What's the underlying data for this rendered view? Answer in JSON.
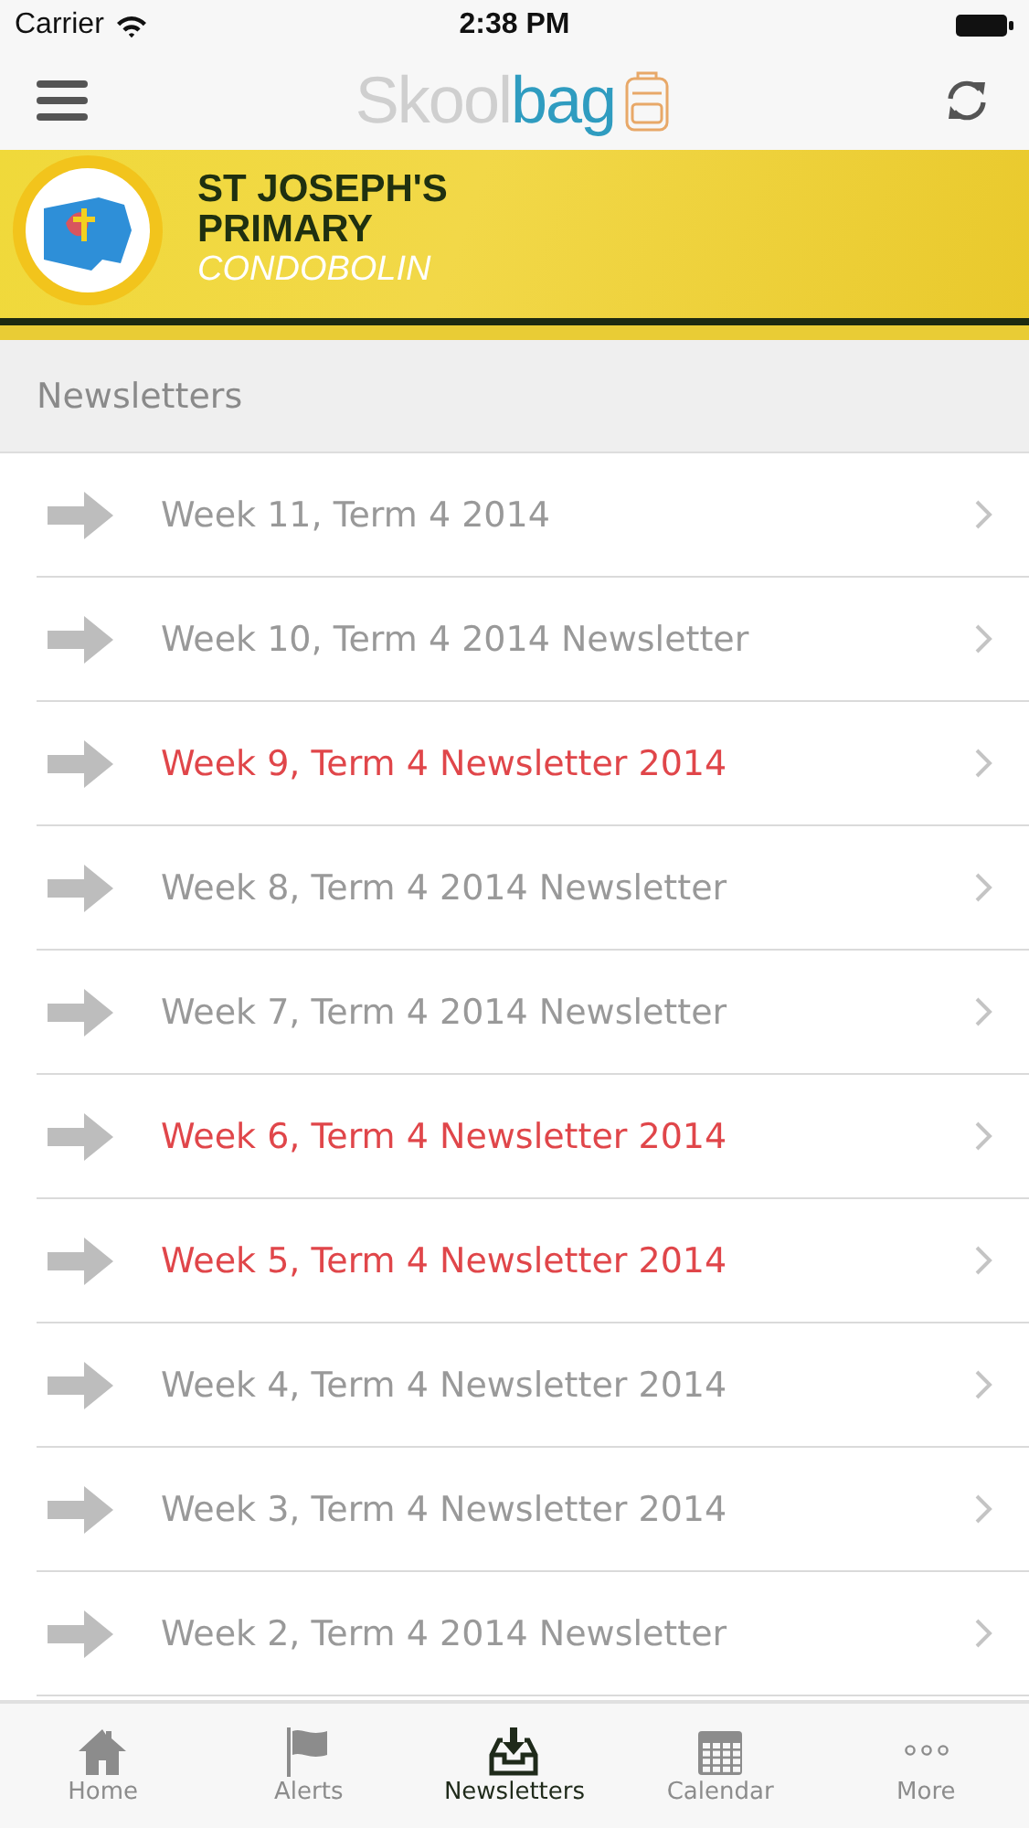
{
  "status_bar": {
    "carrier": "Carrier",
    "time": "2:38 PM"
  },
  "nav_bar": {
    "logo": {
      "first": "Skool",
      "second": "bag"
    }
  },
  "banner": {
    "line1": "ST JOSEPH'S",
    "line2": "PRIMARY",
    "line3": "CONDOBOLIN"
  },
  "section": {
    "title": "Newsletters"
  },
  "items": [
    {
      "label": "Week 11, Term 4 2014",
      "unread": false
    },
    {
      "label": "Week 10, Term 4 2014 Newsletter",
      "unread": false
    },
    {
      "label": "Week 9, Term 4 Newsletter 2014",
      "unread": true
    },
    {
      "label": "Week 8, Term 4 2014 Newsletter",
      "unread": false
    },
    {
      "label": "Week 7, Term 4 2014 Newsletter",
      "unread": false
    },
    {
      "label": "Week 6, Term 4 Newsletter 2014",
      "unread": true
    },
    {
      "label": "Week 5, Term 4 Newsletter 2014",
      "unread": true
    },
    {
      "label": "Week 4, Term 4 Newsletter 2014",
      "unread": false
    },
    {
      "label": "Week 3, Term 4 Newsletter 2014",
      "unread": false
    },
    {
      "label": "Week 2, Term 4 2014 Newsletter",
      "unread": false
    }
  ],
  "tab_bar": [
    {
      "label": "Home",
      "kind": "home",
      "selected": false
    },
    {
      "label": "Alerts",
      "kind": "alerts",
      "selected": false
    },
    {
      "label": "Newsletters",
      "kind": "newsletters",
      "selected": true
    },
    {
      "label": "Calendar",
      "kind": "calendar",
      "selected": false
    },
    {
      "label": "More",
      "kind": "more",
      "selected": false
    }
  ]
}
